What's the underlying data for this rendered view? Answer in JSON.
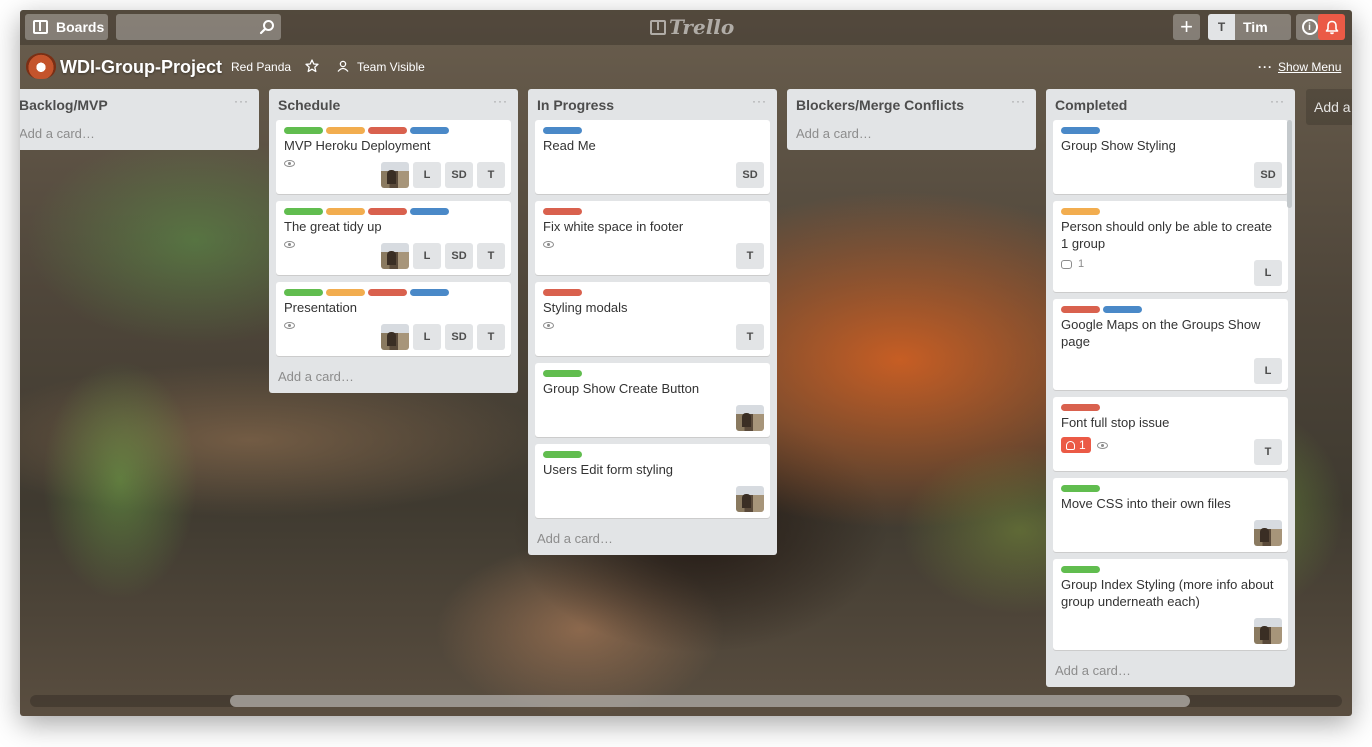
{
  "header": {
    "boards_label": "Boards",
    "search_placeholder": "",
    "logo_text": "Trello",
    "member_initial": "T",
    "member_name": "Tim",
    "add_symbol": "+",
    "info_symbol": "i"
  },
  "board": {
    "title": "WDI-Group-Project",
    "team": "Red Panda",
    "visibility": "Team Visible",
    "show_menu": "Show Menu",
    "more": "···"
  },
  "colors": {
    "green": "#61bd4f",
    "yellow": "#f2ad4f",
    "red": "#d9614e",
    "blue": "#4a89c8",
    "notification": "#eb5a46"
  },
  "lists": [
    {
      "title": "Backlog/MVP",
      "menu": "···",
      "add_card": "Add a card…",
      "cards": []
    },
    {
      "title": "Schedule",
      "menu": "···",
      "add_card": "Add a card…",
      "cards": [
        {
          "title": "MVP Heroku Deployment",
          "labels": [
            "green",
            "yellow",
            "red",
            "blue"
          ],
          "watch": true,
          "members": [
            "photo",
            "L",
            "SD",
            "T"
          ]
        },
        {
          "title": "The great tidy up",
          "labels": [
            "green",
            "yellow",
            "red",
            "blue"
          ],
          "watch": true,
          "members": [
            "photo",
            "L",
            "SD",
            "T"
          ]
        },
        {
          "title": "Presentation",
          "labels": [
            "green",
            "yellow",
            "red",
            "blue"
          ],
          "watch": true,
          "members": [
            "photo",
            "L",
            "SD",
            "T"
          ]
        }
      ]
    },
    {
      "title": "In Progress",
      "menu": "···",
      "add_card": "Add a card…",
      "cards": [
        {
          "title": "Read Me",
          "labels": [
            "blue"
          ],
          "members": [
            "SD"
          ]
        },
        {
          "title": "Fix white space in footer",
          "labels": [
            "red"
          ],
          "watch": true,
          "members": [
            "T"
          ]
        },
        {
          "title": "Styling modals",
          "labels": [
            "red"
          ],
          "watch": true,
          "members": [
            "T"
          ]
        },
        {
          "title": "Group Show Create Button",
          "labels": [
            "green"
          ],
          "members": [
            "photo"
          ]
        },
        {
          "title": "Users Edit form styling",
          "labels": [
            "green"
          ],
          "members": [
            "photo"
          ]
        }
      ]
    },
    {
      "title": "Blockers/Merge Conflicts",
      "menu": "···",
      "add_card": "Add a card…",
      "cards": []
    },
    {
      "title": "Completed",
      "menu": "···",
      "add_card": "Add a card…",
      "cards": [
        {
          "title": "Group Show Styling",
          "labels": [
            "blue"
          ],
          "members": [
            "SD"
          ]
        },
        {
          "title": "Person should only be able to create 1 group",
          "labels": [
            "yellow"
          ],
          "comments": "1",
          "members": [
            "L"
          ]
        },
        {
          "title": "Google Maps on the Groups Show page",
          "labels": [
            "red",
            "blue"
          ],
          "members": [
            "L"
          ]
        },
        {
          "title": "Font full stop issue",
          "labels": [
            "red"
          ],
          "due": "1",
          "watch": true,
          "members": [
            "T"
          ]
        },
        {
          "title": "Move CSS into their own files",
          "labels": [
            "green"
          ],
          "members": [
            "photo"
          ]
        },
        {
          "title": "Group Index Styling (more info about group underneath each)",
          "labels": [
            "green"
          ],
          "members": [
            "photo"
          ]
        }
      ]
    }
  ],
  "add_list": "Add a list…"
}
